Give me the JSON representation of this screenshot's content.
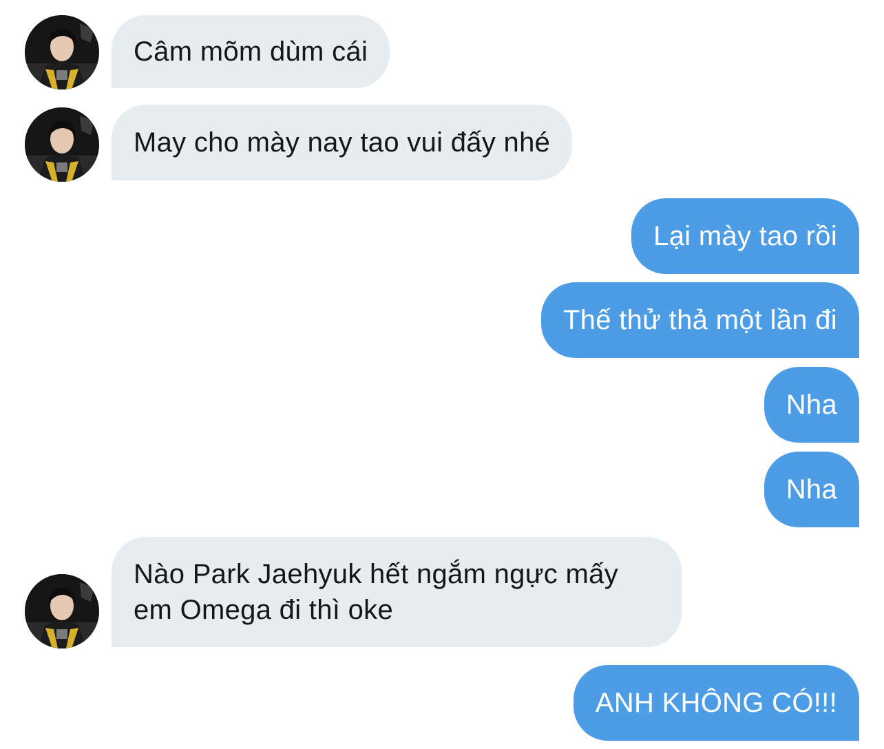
{
  "conversation": {
    "messages": [
      {
        "sender": "them",
        "text": "Câm mõm dùm cái"
      },
      {
        "sender": "them",
        "text": "May cho mày nay tao vui đấy nhé"
      },
      {
        "sender": "me",
        "text": "Lại mày tao rồi"
      },
      {
        "sender": "me",
        "text": "Thế thử thả một lần đi"
      },
      {
        "sender": "me",
        "text": "Nha"
      },
      {
        "sender": "me",
        "text": "Nha"
      },
      {
        "sender": "them",
        "text": "Nào Park Jaehyuk hết ngắm ngực mấy em Omega đi thì oke"
      },
      {
        "sender": "me",
        "text": "ANH KHÔNG CÓ!!!"
      }
    ]
  },
  "colors": {
    "incoming_bubble": "#e6ecf0",
    "outgoing_bubble": "#4d9de6",
    "incoming_text": "#14171a",
    "outgoing_text": "#ffffff"
  },
  "icons": {
    "avatar": "user-avatar-photo"
  }
}
